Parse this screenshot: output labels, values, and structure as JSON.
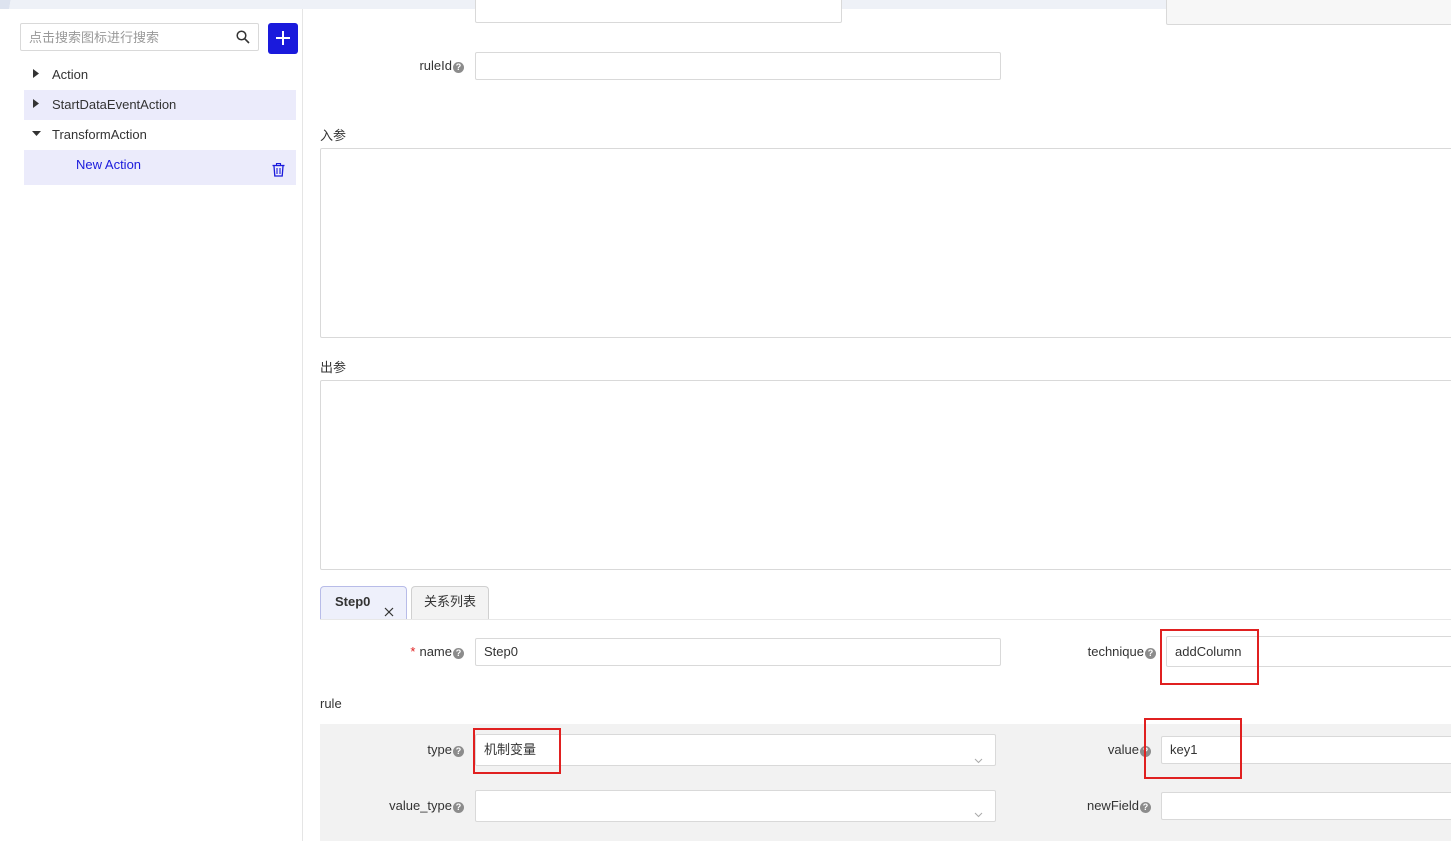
{
  "sidebar": {
    "search_placeholder": "点击搜索图标进行搜索",
    "tree": [
      {
        "label": "Action",
        "expanded": false
      },
      {
        "label": "StartDataEventAction",
        "expanded": false
      },
      {
        "label": "TransformAction",
        "expanded": true,
        "children": [
          {
            "label": "New Action"
          }
        ]
      }
    ]
  },
  "form": {
    "ruleId_label": "ruleId",
    "ruleId_value": "",
    "input_params_label": "入参",
    "output_params_label": "出参",
    "tabs": [
      {
        "label": "Step0"
      },
      {
        "label": "关系列表"
      }
    ],
    "name_label": "name",
    "name_value": "Step0",
    "technique_label": "technique",
    "technique_value": "addColumn",
    "rule_label": "rule",
    "type_label": "type",
    "type_value": "机制变量",
    "value_label": "value",
    "value_value": "key1",
    "value_type_label": "value_type",
    "value_type_value": "",
    "newField_label": "newField",
    "newField_value": "",
    "help_glyph": "?",
    "required_glyph": "*"
  },
  "colors": {
    "accent": "#1a1adc",
    "highlight": "#ebebfb",
    "annotation": "#e02020"
  }
}
